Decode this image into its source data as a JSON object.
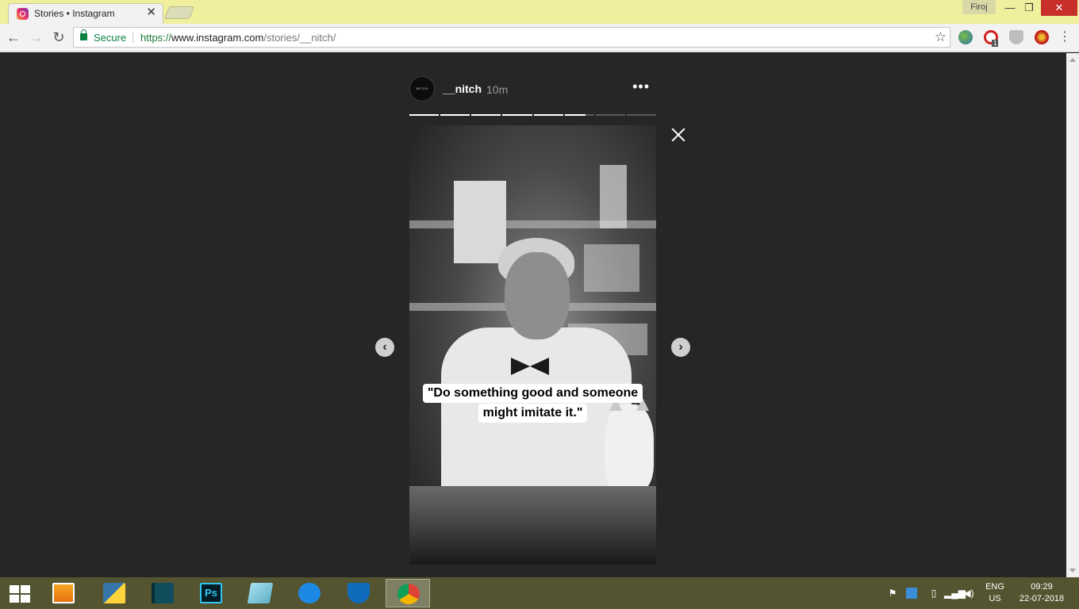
{
  "browser": {
    "tab": {
      "title": "Stories • Instagram",
      "close": "✕"
    },
    "profile": "Firoj",
    "window_controls": {
      "minimize": "—",
      "maximize": "❐",
      "close": "✕"
    },
    "nav": {
      "back": "←",
      "forward": "→",
      "reload": "↻"
    },
    "omnibox": {
      "secure_label": "Secure",
      "url_scheme": "https://",
      "url_host": "www.instagram.com",
      "url_path": "/stories/__nitch/"
    },
    "extensions": [
      "globe-extension-icon",
      "opera-extension-icon",
      "shield-extension-icon",
      "red-extension-icon"
    ],
    "extension_badge": "1",
    "menu": "⋮"
  },
  "story": {
    "avatar_text": "NITCH",
    "username": "__nitch",
    "time_ago": "10m",
    "more": "•••",
    "segments": [
      1,
      1,
      1,
      1,
      1,
      0.7,
      0,
      0
    ],
    "quote_lines": [
      "\"Do something good and someone",
      "might imitate it.\""
    ],
    "prev": "‹",
    "next": "›"
  },
  "taskbar": {
    "apps": [
      "media-player",
      "python-files",
      "app-dark",
      "photoshop",
      "notepad",
      "messenger",
      "defender",
      "chrome"
    ],
    "photoshop_label": "Ps",
    "language": "ENG",
    "region": "US",
    "time": "09:29",
    "date": "22-07-2018"
  },
  "colors": {
    "titlebar": "#efef9d",
    "page_bg": "#262626",
    "secure_green": "#0b8043",
    "taskbar": "#545430"
  }
}
